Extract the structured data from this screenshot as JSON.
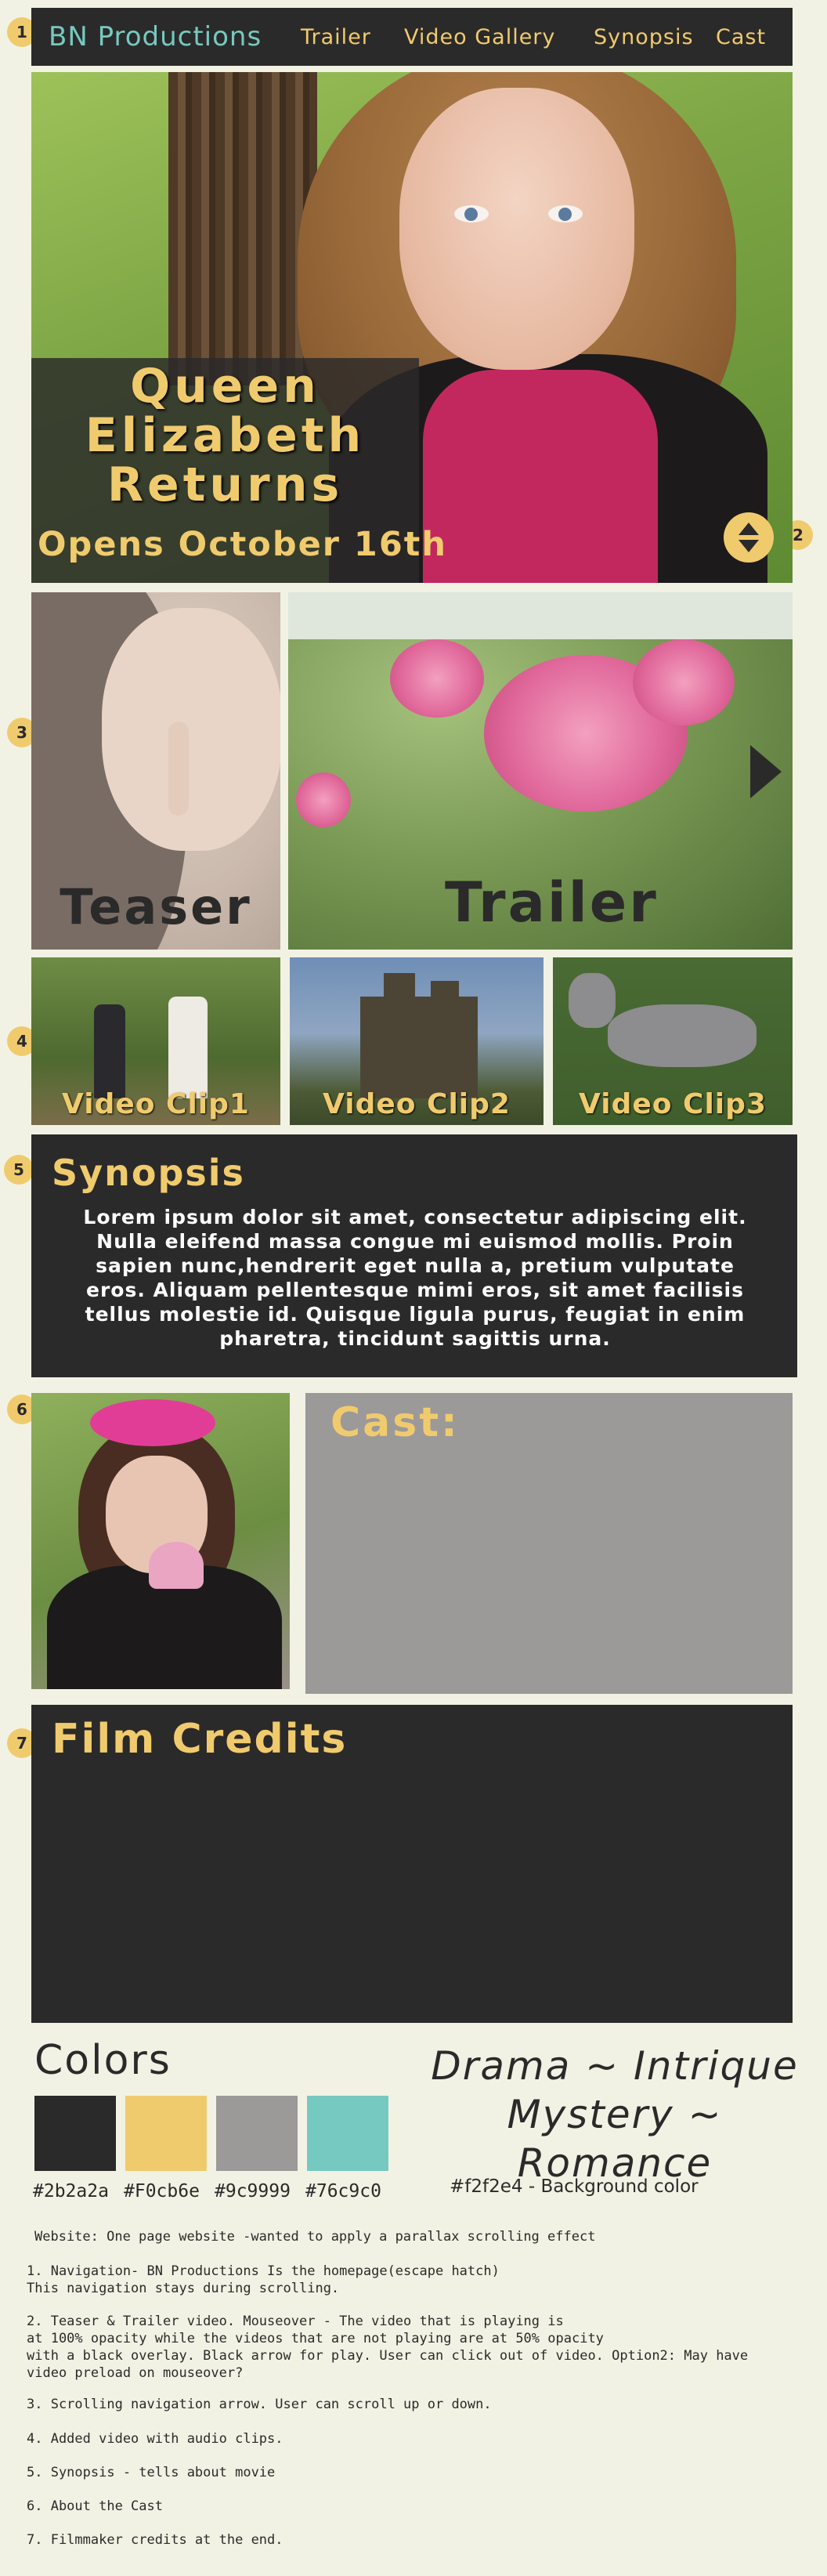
{
  "nav": {
    "brand": "BN Productions",
    "links": [
      "Trailer",
      "Video Gallery",
      "Synopsis",
      "Cast"
    ]
  },
  "markers": [
    "1",
    "2",
    "3",
    "4",
    "5",
    "6",
    "7"
  ],
  "hero": {
    "title": "Queen Elizabeth Returns",
    "date": "Opens October 16th"
  },
  "videos": {
    "teaser": "Teaser",
    "trailer": "Trailer",
    "clips": [
      "Video Clip1",
      "Video Clip2",
      "Video Clip3"
    ]
  },
  "synopsis": {
    "heading": "Synopsis",
    "body": "Lorem ipsum dolor sit amet, consectetur adipiscing elit. Nulla eleifend massa congue mi euismod mollis. Proin sapien nunc,hendrerit eget nulla a, pretium vulputate eros. Aliquam pellentesque mimi eros, sit amet facilisis tellus molestie id. Quisque ligula purus, feugiat in enim pharetra, tincidunt sagittis urna."
  },
  "cast": {
    "heading": "Cast:"
  },
  "credits": {
    "heading": "Film Credits"
  },
  "palette": {
    "heading": "Colors",
    "swatches": [
      {
        "label": "#2b2a2a",
        "color": "#2b2a2a"
      },
      {
        "label": "#F0cb6e",
        "color": "#f0cb6e"
      },
      {
        "label": "#9c9999",
        "color": "#9c9999"
      },
      {
        "label": "#76c9c0",
        "color": "#76c9c0"
      }
    ],
    "tagline_1": "Drama ~ Intrique",
    "tagline_2": "Mystery ~ Romance",
    "background_note": "#f2f2e4 - Background color"
  },
  "notes": {
    "website": "Website: One page website -wanted to apply a parallax scrolling effect",
    "items": [
      "1. Navigation- BN Productions Is the homepage(escape hatch)\nThis navigation stays during scrolling.",
      "2. Teaser & Trailer video. Mouseover - The video that is playing is\nat 100% opacity while the videos that are not playing are at 50% opacity\nwith a black overlay. Black arrow for play. User can click out of video. Option2: May have\nvideo preload on mouseover?",
      "3. Scrolling navigation arrow. User can scroll up or down.",
      "4. Added video with audio clips.",
      "5. Synopsis - tells about movie",
      "6. About the Cast",
      "7. Filmmaker credits at the end."
    ]
  }
}
